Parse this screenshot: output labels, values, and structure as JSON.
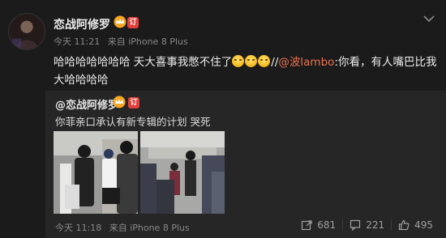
{
  "post": {
    "username": "恋战阿修罗",
    "level_badge": "订",
    "time": "今天 11:21",
    "source": "来自 iPhone 8 Plus",
    "text_before_emoji": "哈哈哈哈哈哈哈 天大喜事我憋不住了",
    "text_separator": "//",
    "mention": "@波lambo",
    "text_after_mention": ":你看，有人嘴巴比我大哈哈哈哈"
  },
  "repost": {
    "username": "@恋战阿修罗",
    "level_badge": "订",
    "text": "你菲亲口承认有新专辑的计划 哭死",
    "time": "今天 11:18",
    "source": "来自 iPhone 8 Plus",
    "actions": {
      "forward_count": "681",
      "comment_count": "221",
      "like_count": "495"
    }
  },
  "colors": {
    "background": "#1b1b1b",
    "card": "#262626",
    "mention": "#eb7350",
    "badge": "#e0403a"
  },
  "icons": [
    "chevron-down-icon",
    "vip-crown-icon",
    "laugh-cry-emoji",
    "forward-icon",
    "comment-icon",
    "like-icon"
  ]
}
